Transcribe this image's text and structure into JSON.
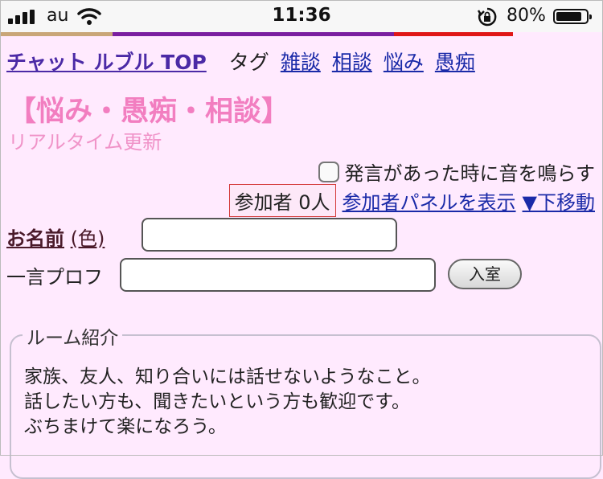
{
  "status": {
    "carrier": "au",
    "time": "11:36",
    "battery": "80%"
  },
  "nav": {
    "top_link": "チャット ルブル TOP",
    "tag_label": "タグ",
    "tags": [
      "雑談",
      "相談",
      "悩み",
      "愚痴"
    ]
  },
  "room": {
    "title": "【悩み・愚痴・相談】",
    "subtitle": "リアルタイム更新"
  },
  "sound_toggle": {
    "label": "発言があった時に音を鳴らす"
  },
  "participants": {
    "count": "参加者 0人",
    "show_panel": "参加者パネルを表示",
    "move_down": "▼下移動"
  },
  "form": {
    "name_label": "お名前",
    "color_label": "(色)",
    "name_value": "",
    "profile_label": "一言プロフ",
    "profile_value": "",
    "enter_button": "入室"
  },
  "intro": {
    "legend": "ルーム紹介",
    "lines": [
      "家族、友人、知り合いには話せないようなこと。",
      "話したい方も、聞きたいという方も歓迎です。",
      "ぶちまけて楽になろう。"
    ]
  }
}
